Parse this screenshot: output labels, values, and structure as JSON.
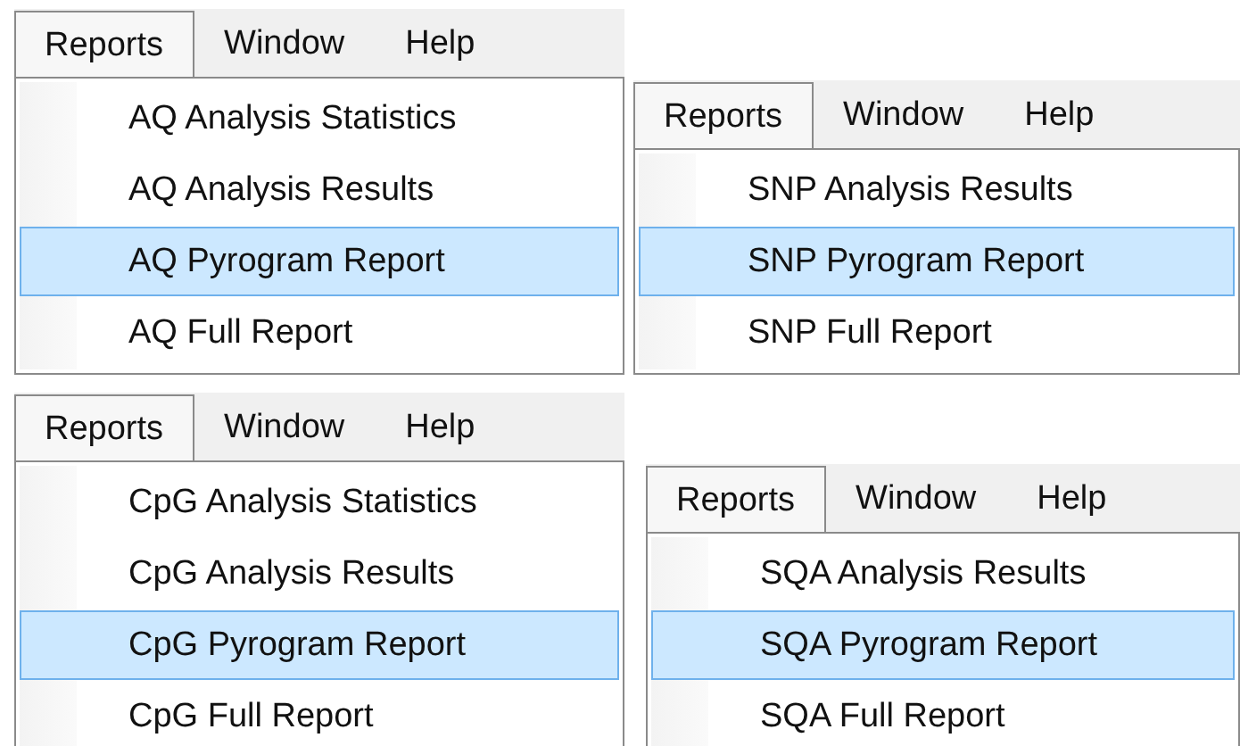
{
  "panels": [
    {
      "menu_bar": [
        {
          "label": "Reports",
          "selected": true
        },
        {
          "label": "Window",
          "selected": false
        },
        {
          "label": "Help",
          "selected": false
        }
      ],
      "items": [
        {
          "label": "AQ Analysis Statistics",
          "selected": false
        },
        {
          "label": "AQ Analysis Results",
          "selected": false
        },
        {
          "label": "AQ Pyrogram Report",
          "selected": true
        },
        {
          "label": "AQ Full Report",
          "selected": false
        }
      ]
    },
    {
      "menu_bar": [
        {
          "label": "Reports",
          "selected": true
        },
        {
          "label": "Window",
          "selected": false
        },
        {
          "label": "Help",
          "selected": false
        }
      ],
      "items": [
        {
          "label": "SNP Analysis Results",
          "selected": false
        },
        {
          "label": "SNP Pyrogram Report",
          "selected": true
        },
        {
          "label": "SNP Full Report",
          "selected": false
        }
      ]
    },
    {
      "menu_bar": [
        {
          "label": "Reports",
          "selected": true
        },
        {
          "label": "Window",
          "selected": false
        },
        {
          "label": "Help",
          "selected": false
        }
      ],
      "items": [
        {
          "label": "CpG Analysis Statistics",
          "selected": false
        },
        {
          "label": "CpG Analysis Results",
          "selected": false
        },
        {
          "label": "CpG Pyrogram Report",
          "selected": true
        },
        {
          "label": "CpG Full Report",
          "selected": false
        }
      ]
    },
    {
      "menu_bar": [
        {
          "label": "Reports",
          "selected": true
        },
        {
          "label": "Window",
          "selected": false
        },
        {
          "label": "Help",
          "selected": false
        }
      ],
      "items": [
        {
          "label": "SQA Analysis Results",
          "selected": false
        },
        {
          "label": "SQA Pyrogram Report",
          "selected": true
        },
        {
          "label": "SQA Full Report",
          "selected": false
        }
      ]
    }
  ]
}
